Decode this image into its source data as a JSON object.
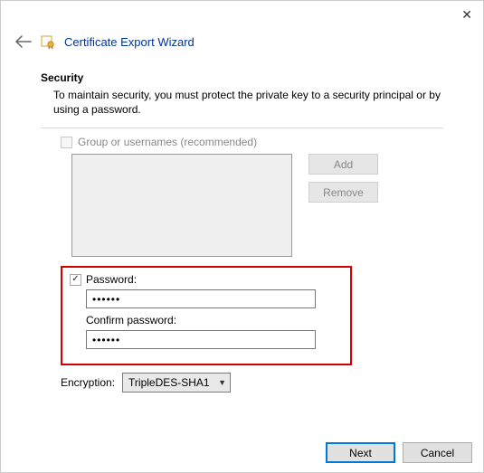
{
  "window": {
    "title": "Certificate Export Wizard"
  },
  "section": {
    "heading": "Security",
    "description": "To maintain security, you must protect the private key to a security principal or by using a password."
  },
  "group": {
    "checkbox_label": "Group or usernames (recommended)",
    "checked": false,
    "add_label": "Add",
    "remove_label": "Remove"
  },
  "password": {
    "checkbox_label": "Password:",
    "checked": true,
    "value": "••••••",
    "confirm_label": "Confirm password:",
    "confirm_value": "••••••"
  },
  "encryption": {
    "label": "Encryption:",
    "value": "TripleDES-SHA1"
  },
  "footer": {
    "next_label": "Next",
    "cancel_label": "Cancel"
  }
}
